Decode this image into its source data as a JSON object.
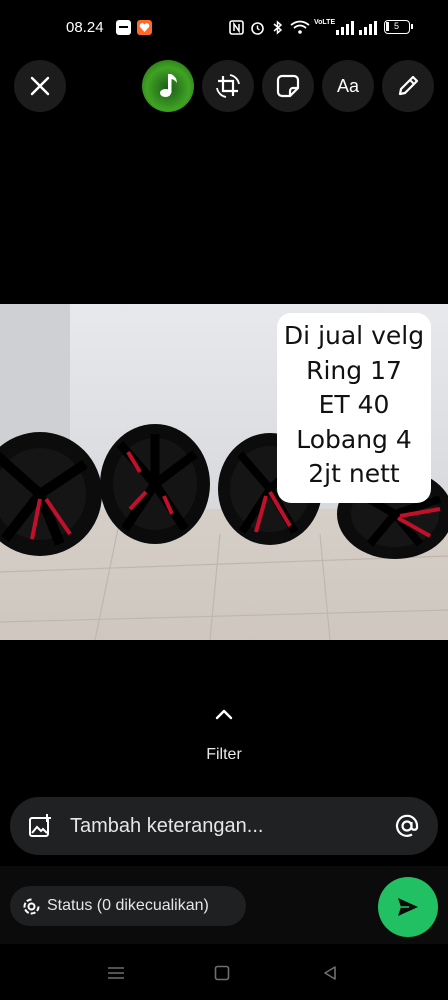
{
  "status_bar": {
    "time": "08.24",
    "battery": "5",
    "volte_label": "VoLTE",
    "icons": [
      "messages-icon",
      "heart-app-icon",
      "nfc-icon",
      "alarm-icon",
      "bluetooth-icon",
      "wifi-icon",
      "signal-icon",
      "signal-icon",
      "battery-icon"
    ]
  },
  "toolbar": {
    "buttons": [
      "close-icon",
      "music-icon",
      "crop-rotate-icon",
      "sticker-icon",
      "text-icon",
      "pencil-icon"
    ],
    "text_label": "Aa"
  },
  "photo": {
    "overlay_lines": [
      "Di jual velg",
      "Ring 17",
      "ET 40",
      "Lobang 4",
      "2jt nett"
    ],
    "colors": {
      "rim": "#0c0c0c",
      "spoke_accent": "#c0102a",
      "wall": "#e6e7ea",
      "floor": "#d9d3cc"
    }
  },
  "filter": {
    "label": "Filter"
  },
  "caption": {
    "placeholder": "Tambah keterangan...",
    "add_media_icon": "add-image-icon",
    "mention_icon": "at-icon"
  },
  "status": {
    "label": "Status (0 dikecualikan)"
  },
  "send": {
    "color": "#21c063",
    "icon": "send-icon"
  },
  "nav": {
    "items": [
      "menu-icon",
      "home-icon",
      "back-icon"
    ]
  }
}
